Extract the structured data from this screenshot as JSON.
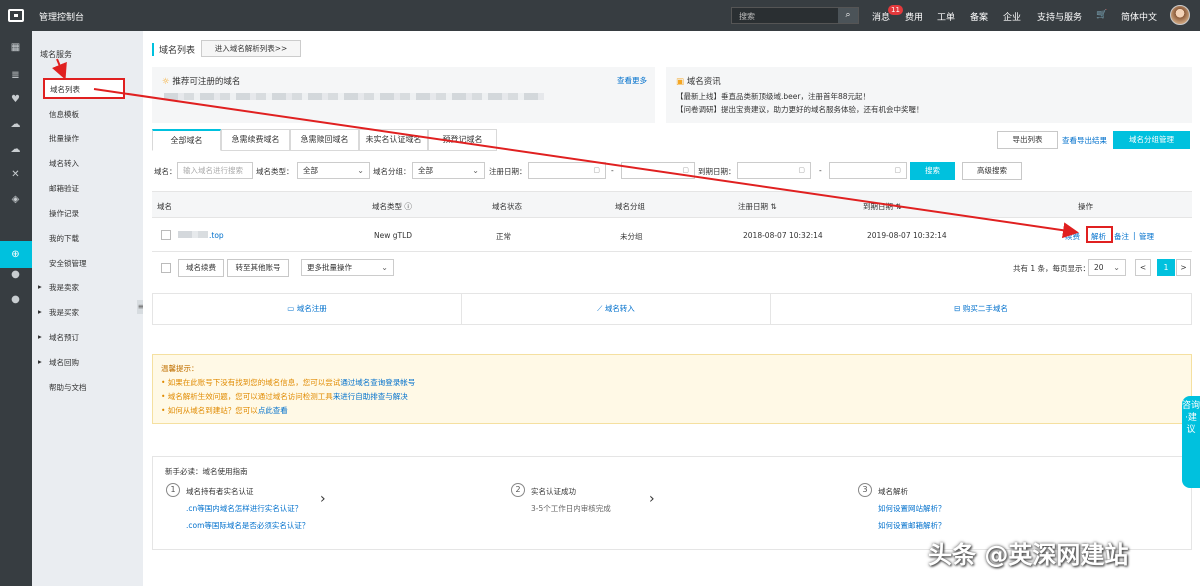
{
  "topbar": {
    "console": "管理控制台",
    "search_placeholder": "搜索",
    "messages": "消息",
    "messages_badge": "11",
    "nav": [
      "费用",
      "工单",
      "备案",
      "企业",
      "支持与服务",
      "简体中文"
    ]
  },
  "rail_icons": [
    "grid-icon",
    "list-icon",
    "heart-icon",
    "cloud-icon",
    "cloud-upload-icon",
    "shuffle-icon",
    "layers-icon",
    "globe-icon",
    "circle-icon",
    "circle-icon",
    "cloud-icon"
  ],
  "sidebar": {
    "section": "域名服务",
    "selected": "域名列表",
    "items": [
      "信息模板",
      "批量操作",
      "域名转入",
      "邮箱验证",
      "操作记录",
      "我的下载",
      "安全锁管理"
    ],
    "groups": [
      "我是卖家",
      "我是买家",
      "域名预订",
      "域名回购"
    ],
    "help": "帮助与文档"
  },
  "main": {
    "title": "域名列表",
    "goto_dns": "进入域名解析列表>>",
    "recommend": {
      "title": "推荐可注册的域名",
      "more": "查看更多"
    },
    "news": {
      "title": "域名资讯",
      "line1": "【最新上线】垂直品类新顶级域.beer，注册首年88元起！",
      "line2": "【问卷调研】提出宝贵建议，助力更好的域名服务体验，还有机会中奖喔！"
    },
    "tabs": [
      "全部域名",
      "急需续费域名",
      "急需赎回域名",
      "未实名认证域名",
      "预登记域名"
    ],
    "export_list": "导出列表",
    "view_export": "查看导出结果",
    "group_manage": "域名分组管理",
    "filters": {
      "domain_label": "域名：",
      "domain_placeholder": "输入域名进行搜索",
      "type_label": "域名类型：",
      "type_value": "全部",
      "group_label": "域名分组：",
      "group_value": "全部",
      "reg_date_label": "注册日期：",
      "exp_date_label": "到期日期：",
      "dash": "-",
      "search": "搜索",
      "advanced": "高级搜索"
    },
    "table": {
      "headers": [
        "域名",
        "域名类型",
        "域名状态",
        "域名分组",
        "注册日期",
        "到期日期",
        "操作"
      ],
      "rows": [
        {
          "domain": ".top",
          "type": "New gTLD",
          "status": "正常",
          "group": "未分组",
          "reg": "2018-08-07 10:32:14",
          "exp": "2019-08-07 10:32:14",
          "ops": [
            "续费",
            "解析",
            "备注",
            "管理"
          ]
        }
      ]
    },
    "footer": {
      "renew": "域名续费",
      "transfer": "转至其他账号",
      "more_ops": "更多批量操作",
      "total": "共有 1 条，每页显示：",
      "page_size": "20",
      "page": "1",
      "prev": "<",
      "next": ">"
    },
    "actions": [
      "域名注册",
      "域名转入",
      "购买二手域名"
    ],
    "tips": {
      "title": "温馨提示：",
      "line1_a": "• 如果在此账号下没有找到您的域名信息，您可以尝试",
      "line1_b": "通过域名查询登录帐号",
      "line2_a": "• 域名解析生效问题，您可以通过域名访问检测工具",
      "line2_b": "来进行自助排查与解决",
      "line3_a": "• 如何从域名到建站？您可以",
      "line3_b": "点此查看"
    },
    "guide": {
      "title": "新手必读：域名使用指南",
      "step1": {
        "num": "1",
        "title": "域名持有者实名认证",
        "l1": ".cn等国内域名怎样进行实名认证？",
        "l2": ".com等国际域名是否必须实名认证？"
      },
      "step2": {
        "num": "2",
        "title": "实名认证成功",
        "sub": "3-5个工作日内审核完成"
      },
      "step3": {
        "num": "3",
        "title": "域名解析",
        "l1": "如何设置网站解析？",
        "l2": "如何设置邮箱解析？"
      }
    }
  },
  "consult": "咨询·建议",
  "watermark": "头条 @英深网建站",
  "colors": {
    "accent": "#00c1de",
    "topbar": "#373d41",
    "annotation": "#e02020"
  }
}
